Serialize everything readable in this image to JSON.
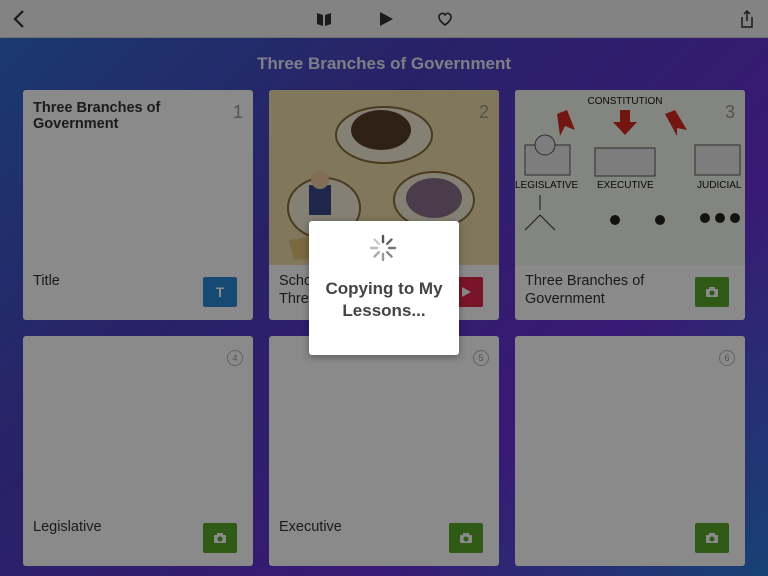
{
  "page": {
    "title": "Three Branches of Government"
  },
  "toolbar": {
    "icons": [
      "chevron-left-icon",
      "library-icon",
      "play-icon",
      "heart-icon",
      "share-icon"
    ]
  },
  "cards": [
    {
      "number": "1",
      "heading": "Three Branches of Government",
      "label": "Title",
      "type": "text",
      "type_glyph": "T",
      "type_color": "#2a8ad6"
    },
    {
      "number": "2",
      "label": "School House Rock Three Ring...",
      "label_visible": "Scho\nThre",
      "type": "video",
      "type_color": "#e0284a"
    },
    {
      "number": "3",
      "label": "Three Branches of Government",
      "type": "photo",
      "type_color": "#5aa82a"
    },
    {
      "number": "4",
      "label": "Legislative",
      "type": "photo",
      "type_color": "#5aa82a"
    },
    {
      "number": "5",
      "label": "Executive",
      "type": "photo",
      "type_color": "#5aa82a"
    },
    {
      "number": "6",
      "label": "",
      "type": "photo",
      "type_color": "#5aa82a"
    }
  ],
  "diagram": {
    "constitution": "CONSTITUTION",
    "legislative": "LEGISLATIVE",
    "executive": "EXECUTIVE",
    "judicial": "JUDICIAL"
  },
  "modal": {
    "message": "Copying to My Lessons..."
  }
}
